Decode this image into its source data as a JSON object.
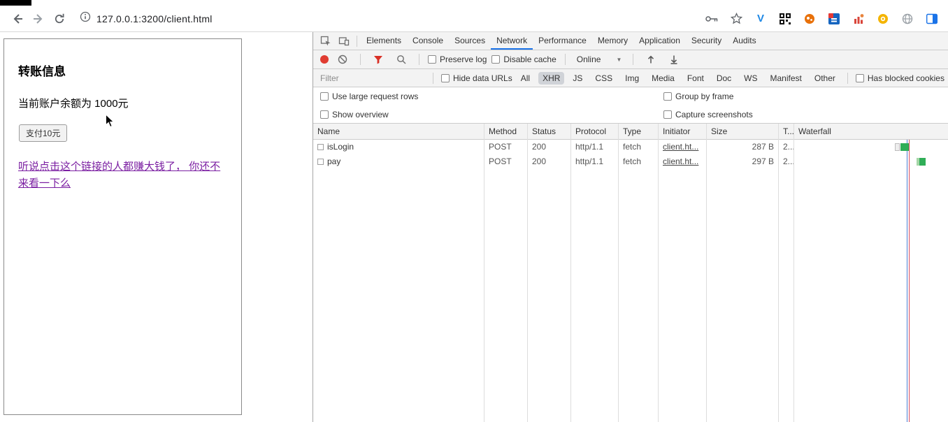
{
  "browser": {
    "url": "127.0.0.1:3200/client.html"
  },
  "page": {
    "heading": "转账信息",
    "balance_text": "当前账户余额为 1000元",
    "pay_button_label": "支付10元",
    "link_text": "听说点击这个链接的人都赚大钱了， 你还不来看一下么"
  },
  "devtools": {
    "tabs": [
      "Elements",
      "Console",
      "Sources",
      "Network",
      "Performance",
      "Memory",
      "Application",
      "Security",
      "Audits"
    ],
    "active_tab": "Network",
    "toolbar": {
      "preserve_log_label": "Preserve log",
      "disable_cache_label": "Disable cache",
      "throttling_value": "Online"
    },
    "filter_bar": {
      "filter_placeholder": "Filter",
      "hide_data_urls_label": "Hide data URLs",
      "type_filters": [
        "All",
        "XHR",
        "JS",
        "CSS",
        "Img",
        "Media",
        "Font",
        "Doc",
        "WS",
        "Manifest",
        "Other"
      ],
      "active_type_filter": "XHR",
      "has_blocked_cookies_label": "Has blocked cookies"
    },
    "options": {
      "use_large_request_rows_label": "Use large request rows",
      "group_by_frame_label": "Group by frame",
      "show_overview_label": "Show overview",
      "capture_screenshots_label": "Capture screenshots"
    },
    "network_table": {
      "columns": [
        "Name",
        "Method",
        "Status",
        "Protocol",
        "Type",
        "Initiator",
        "Size",
        "T...",
        "Waterfall"
      ],
      "rows": [
        {
          "name": "isLogin",
          "method": "POST",
          "status": "200",
          "protocol": "http/1.1",
          "type": "fetch",
          "initiator": "client.ht...",
          "size": "287 B",
          "time": "2..."
        },
        {
          "name": "pay",
          "method": "POST",
          "status": "200",
          "protocol": "http/1.1",
          "type": "fetch",
          "initiator": "client.ht...",
          "size": "297 B",
          "time": "2..."
        }
      ]
    },
    "colors": {
      "accent_blue": "#1a73e8",
      "record_red": "#e03c31",
      "filter_funnel_red": "#d93025",
      "waterfall_green": "#2fae57",
      "waterfall_load_line_red": "#d64a5e",
      "waterfall_dcl_line_blue": "#4a7fd4",
      "page_link_purple": "#7b1fa2"
    }
  }
}
